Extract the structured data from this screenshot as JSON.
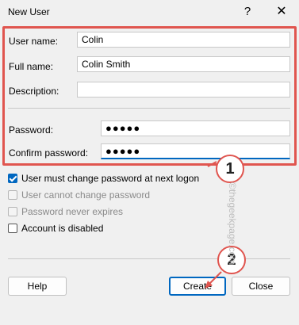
{
  "window": {
    "title": "New User",
    "help_glyph": "?",
    "close_glyph": "✕"
  },
  "form": {
    "username": {
      "label": "User name:",
      "value": "Colin"
    },
    "fullname": {
      "label": "Full name:",
      "value": "Colin Smith"
    },
    "description": {
      "label": "Description:",
      "value": ""
    },
    "password": {
      "label": "Password:",
      "value": "●●●●●"
    },
    "confirm": {
      "label": "Confirm password:",
      "value": "●●●●●"
    }
  },
  "options": [
    {
      "label": "User must change password at next logon",
      "checked": true,
      "enabled": true
    },
    {
      "label": "User cannot change password",
      "checked": false,
      "enabled": false
    },
    {
      "label": "Password never expires",
      "checked": false,
      "enabled": false
    },
    {
      "label": "Account is disabled",
      "checked": false,
      "enabled": true
    }
  ],
  "buttons": {
    "help": "Help",
    "create": "Create",
    "close": "Close"
  },
  "annotations": {
    "step1": "1",
    "step2": "2"
  },
  "watermark": "©thegeekpage.com",
  "colors": {
    "highlight_box": "#e0554f",
    "accent": "#0067c0"
  }
}
